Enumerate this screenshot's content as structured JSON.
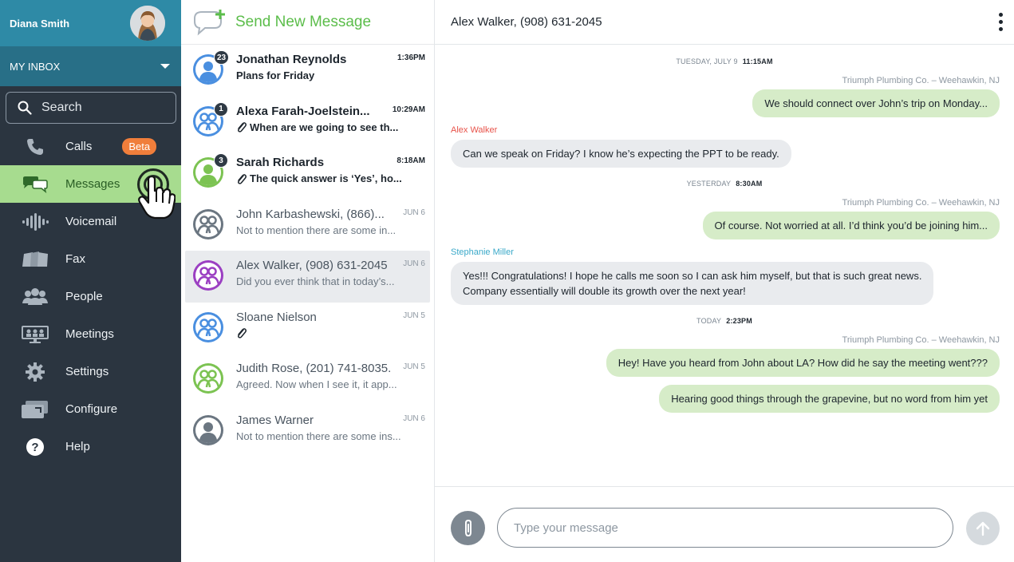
{
  "sidebar": {
    "user_name": "Diana Smith",
    "inbox_label": "MY INBOX",
    "search_label": "Search",
    "beta_label": "Beta",
    "items": [
      {
        "label": "Calls",
        "icon": "phone-icon"
      },
      {
        "label": "Messages",
        "icon": "chat-bubbles-icon"
      },
      {
        "label": "Voicemail",
        "icon": "waveform-icon"
      },
      {
        "label": "Fax",
        "icon": "fax-icon"
      },
      {
        "label": "People",
        "icon": "people-icon"
      },
      {
        "label": "Meetings",
        "icon": "meetings-icon"
      },
      {
        "label": "Settings",
        "icon": "gear-icon"
      },
      {
        "label": "Configure",
        "icon": "configure-icon"
      },
      {
        "label": "Help",
        "icon": "help-icon"
      }
    ]
  },
  "list": {
    "header": "Send New Message",
    "conversations": [
      {
        "name": "Jonathan Reynolds",
        "preview": "Plans for Friday",
        "time": "1:36PM",
        "count": "23",
        "unread": true,
        "color": "#4a8fe0",
        "kind": "person"
      },
      {
        "name": "Alexa Farah-Joelstein...",
        "preview": "When are we going to see th...",
        "time": "10:29AM",
        "count": "1",
        "unread": true,
        "color": "#4a8fe0",
        "kind": "group",
        "attachment": true
      },
      {
        "name": "Sarah Richards",
        "preview": "The quick answer is ‘Yes’, ho...",
        "time": "8:18AM",
        "count": "3",
        "unread": true,
        "color": "#7cc352",
        "kind": "person",
        "attachment": true
      },
      {
        "name": "John Karbashewski, (866)...",
        "preview": "Not to mention there are some in...",
        "time": "JUN 6",
        "unread": false,
        "color": "#6b7681",
        "kind": "group"
      },
      {
        "name": "Alex Walker, (908) 631-2045",
        "preview": "Did you ever think that in today’s...",
        "time": "JUN 6",
        "unread": false,
        "color": "#9b3fc2",
        "kind": "group",
        "selected": true
      },
      {
        "name": "Sloane Nielson",
        "preview": "",
        "time": "JUN 5",
        "unread": false,
        "color": "#4a8fe0",
        "kind": "group",
        "attachment": true
      },
      {
        "name": "Judith Rose, (201) 741-8035...",
        "preview": "Agreed. Now when I see it, it app...",
        "time": "JUN 5",
        "unread": false,
        "color": "#7cc352",
        "kind": "group"
      },
      {
        "name": "James Warner",
        "preview": "Not to mention there are some ins...",
        "time": "JUN 6",
        "unread": false,
        "color": "#6b7681",
        "kind": "person"
      }
    ]
  },
  "chat": {
    "title": "Alex Walker, (908) 631-2045",
    "days": [
      {
        "label": "TUESDAY, JULY 9",
        "time": "11:15AM"
      },
      {
        "label": "YESTERDAY",
        "time": "8:30AM"
      },
      {
        "label": "TODAY",
        "time": "2:23PM"
      }
    ],
    "company": "Triumph Plumbing Co. – Weehawkin, NJ",
    "senders": {
      "alex": "Alex Walker",
      "stephanie": "Stephanie Miller"
    },
    "sender_colors": {
      "alex": "#e8534a",
      "stephanie": "#3aa9c9"
    },
    "messages": [
      "We should connect over John’s trip on Monday...",
      "Can we speak on Friday? I know he’s expecting the PPT to be ready.",
      "Of course. Not worried at all. I’d think you’d be joining him...",
      "Yes!!! Congratulations! I hope he calls me soon so I can ask him myself, but that is such great news.",
      "Company essentially will double its growth over the next year!",
      "Hey! Have you heard from John about LA? How did he say the meeting went???",
      "Hearing good things through the grapevine, but no word from him yet"
    ],
    "composer_placeholder": "Type your message"
  },
  "colors": {
    "accent_green": "#5bbd4a",
    "active_nav": "#a7dc8f",
    "beta": "#f07e3b",
    "header_teal": "#2e8aa6"
  }
}
